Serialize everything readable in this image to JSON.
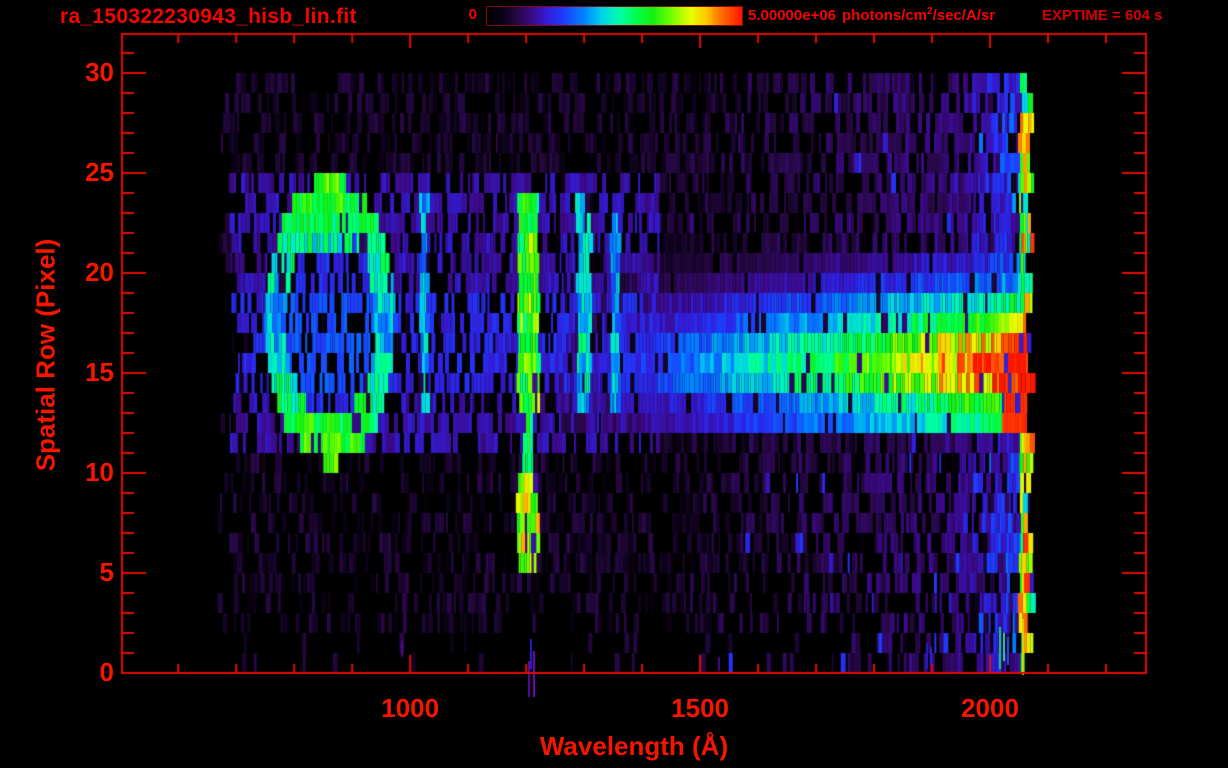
{
  "window": {
    "background_color": "#000000"
  },
  "chart_data": {
    "type": "heatmap",
    "title": "ra_150322230943_hisb_lin.fit",
    "xlabel": "Wavelength (Å)",
    "ylabel": "Spatial Row (Pixel)",
    "exptime_label": "EXPTIME = 604 s",
    "x_range": [
      503,
      2269
    ],
    "y_range": [
      0,
      31.95
    ],
    "x_major_ticks": [
      1000,
      1500,
      2000
    ],
    "x_tick_labels": [
      "1000",
      "1500",
      "2000"
    ],
    "x_minor_tick_step": 100,
    "x_minor_tick_start": 600,
    "x_minor_tick_end": 2200,
    "y_major_ticks": [
      0,
      5,
      10,
      15,
      20,
      25,
      30
    ],
    "y_tick_labels": [
      "0",
      "5",
      "10",
      "15",
      "20",
      "25",
      "30"
    ],
    "y_minor_tick_step": 1,
    "frame_color": "#e00d00",
    "label_color": "#f61600",
    "colorbar": {
      "min_label": "0",
      "max_value": "5.00000e+06",
      "unit_prefix": "photons/cm",
      "unit_sup": "2",
      "unit_suffix": "/sec/A/sr",
      "border_color": "#7d1000"
    },
    "colormap_stops": [
      [
        0.0,
        0,
        0,
        0
      ],
      [
        0.06,
        10,
        2,
        20
      ],
      [
        0.12,
        40,
        8,
        70
      ],
      [
        0.18,
        60,
        10,
        140
      ],
      [
        0.24,
        50,
        30,
        220
      ],
      [
        0.3,
        30,
        60,
        255
      ],
      [
        0.38,
        0,
        130,
        255
      ],
      [
        0.45,
        0,
        210,
        235
      ],
      [
        0.52,
        0,
        255,
        170
      ],
      [
        0.58,
        0,
        255,
        80
      ],
      [
        0.65,
        20,
        240,
        20
      ],
      [
        0.72,
        110,
        255,
        0
      ],
      [
        0.8,
        230,
        255,
        0
      ],
      [
        0.86,
        255,
        200,
        0
      ],
      [
        0.91,
        255,
        120,
        0
      ],
      [
        1.0,
        255,
        20,
        0
      ]
    ],
    "data_extent": {
      "lambda_min": 682,
      "lambda_max": 2066,
      "row_min": 1,
      "row_max": 30
    },
    "noise": {
      "base_intensity": 0.055,
      "right_ramp_intensity": 0.085,
      "fill_mid_rows": 0.62,
      "fill_upper_rows": 0.5,
      "fill_lower_rows": 0.32,
      "right_fill_boost": 0.33
    },
    "mid_band": {
      "rows": [
        11.5,
        24.5
      ],
      "lambda": [
        690,
        1430
      ],
      "intensity": 0.11
    },
    "features": [
      {
        "name": "airglow-ring",
        "center_lambda": 862,
        "center_row": 17.6,
        "radius_lambda": 97,
        "radius_rows": 6.1,
        "intensity": 0.5
      },
      {
        "name": "ring-bottom-blob",
        "lambda": [
          808,
          905
        ],
        "rows": [
          10.8,
          13.2
        ],
        "intensity": 0.62
      },
      {
        "name": "ring-top-blob",
        "lambda": [
          812,
          902
        ],
        "rows": [
          20.8,
          23.6
        ],
        "intensity": 0.55
      },
      {
        "name": "lyman-beta-line",
        "lambda": [
          1017,
          1031
        ],
        "rows": [
          13.5,
          23.5
        ],
        "intensity": 0.4
      },
      {
        "name": "lyman-alpha-line",
        "lambda": [
          1186,
          1222
        ],
        "rows": [
          4.8,
          24.2
        ],
        "intensity": 0.65
      },
      {
        "name": "oi-1304-line",
        "lambda": [
          1288,
          1312
        ],
        "rows": [
          13.5,
          24.2
        ],
        "intensity": 0.47
      },
      {
        "name": "oi-1356-line",
        "lambda": [
          1346,
          1362
        ],
        "rows": [
          13.5,
          23.2
        ],
        "intensity": 0.4
      },
      {
        "name": "continuum-trace",
        "lambda_start": 1260,
        "lambda_end": 2066,
        "row_weights": {
          "13": 0.62,
          "14": 0.72,
          "15": 1.0,
          "16": 1.05,
          "17": 0.95,
          "18": 0.75,
          "19": 0.6,
          "20": 0.4,
          "21": 0.28
        },
        "ramp": [
          0.18,
          0.8
        ]
      },
      {
        "name": "red-hotspot",
        "lambda": [
          2020,
          2066
        ],
        "rows_bands": [
          13,
          17
        ],
        "intensity": 0.93
      },
      {
        "name": "detector-edge-burst",
        "lambda": [
          2050,
          2070
        ],
        "intensity": 0.75
      }
    ],
    "artifacts": [
      {
        "lambda": 1204,
        "row_top": 0.6,
        "row_bottom": -1.2,
        "width_lambda": 4,
        "color": "#5c0ca0"
      },
      {
        "lambda": 1211,
        "row_top": 1.1,
        "row_bottom": -1.2,
        "width_lambda": 4,
        "color": "#6a10b4"
      },
      {
        "lambda": 1207,
        "row_top": 1.7,
        "row_bottom": 0.2,
        "width_lambda": 3,
        "color": "#2a20c8"
      },
      {
        "lambda": 985,
        "row_top": 1.6,
        "row_bottom": 0.8,
        "width_lambda": 4,
        "color": "#4a0a86"
      },
      {
        "lambda": 1531,
        "row_top": 0.8,
        "row_bottom": 0.1,
        "width_lambda": 3,
        "color": "#4a0a86"
      },
      {
        "lambda": 1890,
        "row_top": 1.5,
        "row_bottom": 0.2,
        "width_lambda": 3,
        "color": "#2222cc"
      },
      {
        "lambda": 1897,
        "row_top": 1.3,
        "row_bottom": 0.4,
        "width_lambda": 3,
        "color": "#2a2ad4"
      },
      {
        "lambda": 2016,
        "row_top": 2.3,
        "row_bottom": 0.2,
        "width_lambda": 3,
        "color": "#20c878"
      },
      {
        "lambda": 2023,
        "row_top": 2.0,
        "row_bottom": 0.6,
        "width_lambda": 3,
        "color": "#30d0c8"
      },
      {
        "lambda": 2029,
        "row_top": 1.8,
        "row_bottom": 0.4,
        "width_lambda": 3,
        "color": "#2a50d8"
      },
      {
        "lambda": 2055,
        "row_top": 2.7,
        "row_bottom": -0.1,
        "width_lambda": 4,
        "color": "#e0d400"
      }
    ]
  }
}
